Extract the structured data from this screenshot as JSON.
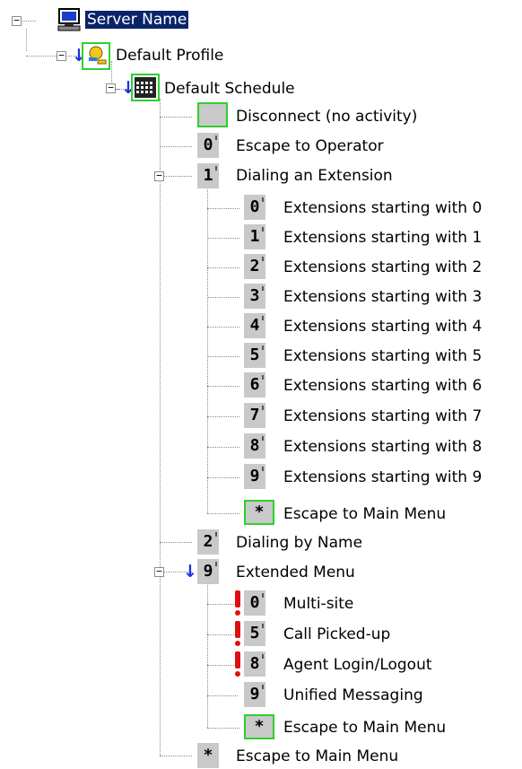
{
  "tree": {
    "server": {
      "label": "Server Name",
      "icon": "computer-icon"
    },
    "profile": {
      "label": "Default Profile",
      "icon": "profile-key-icon"
    },
    "schedule": {
      "label": "Default Schedule",
      "icon": "calendar-icon"
    },
    "disconnect": {
      "label": "Disconnect (no activity)"
    },
    "escape_operator": {
      "key": "0",
      "label": "Escape to Operator"
    },
    "dialing_extension": {
      "key": "1",
      "label": "Dialing an Extension",
      "children": [
        {
          "key": "0",
          "label": "Extensions starting with 0"
        },
        {
          "key": "1",
          "label": "Extensions starting with 1"
        },
        {
          "key": "2",
          "label": "Extensions starting with 2"
        },
        {
          "key": "3",
          "label": "Extensions starting with 3"
        },
        {
          "key": "4",
          "label": "Extensions starting with 4"
        },
        {
          "key": "5",
          "label": "Extensions starting with 5"
        },
        {
          "key": "6",
          "label": "Extensions starting with 6"
        },
        {
          "key": "7",
          "label": "Extensions starting with 7"
        },
        {
          "key": "8",
          "label": "Extensions starting with 8"
        },
        {
          "key": "9",
          "label": "Extensions starting with 9"
        },
        {
          "key": "*",
          "label": "Escape to Main Menu"
        }
      ]
    },
    "dialing_name": {
      "key": "2",
      "label": "Dialing by Name"
    },
    "extended_menu": {
      "key": "9",
      "label": "Extended Menu",
      "children": [
        {
          "key": "0",
          "label": "Multi-site",
          "warning": true
        },
        {
          "key": "5",
          "label": "Call Picked-up",
          "warning": true
        },
        {
          "key": "8",
          "label": "Agent Login/Logout",
          "warning": true
        },
        {
          "key": "9",
          "label": "Unified Messaging",
          "warning": false
        },
        {
          "key": "*",
          "label": "Escape to Main Menu",
          "warning": false
        }
      ]
    },
    "escape_main": {
      "key": "*",
      "label": "Escape to Main Menu"
    }
  },
  "colors": {
    "selection_bg": "#0a246a",
    "key_bg": "#c9c9c9",
    "selected_border": "#2ed02e",
    "warning": "#e01010",
    "arrow": "#1a2fe0"
  }
}
